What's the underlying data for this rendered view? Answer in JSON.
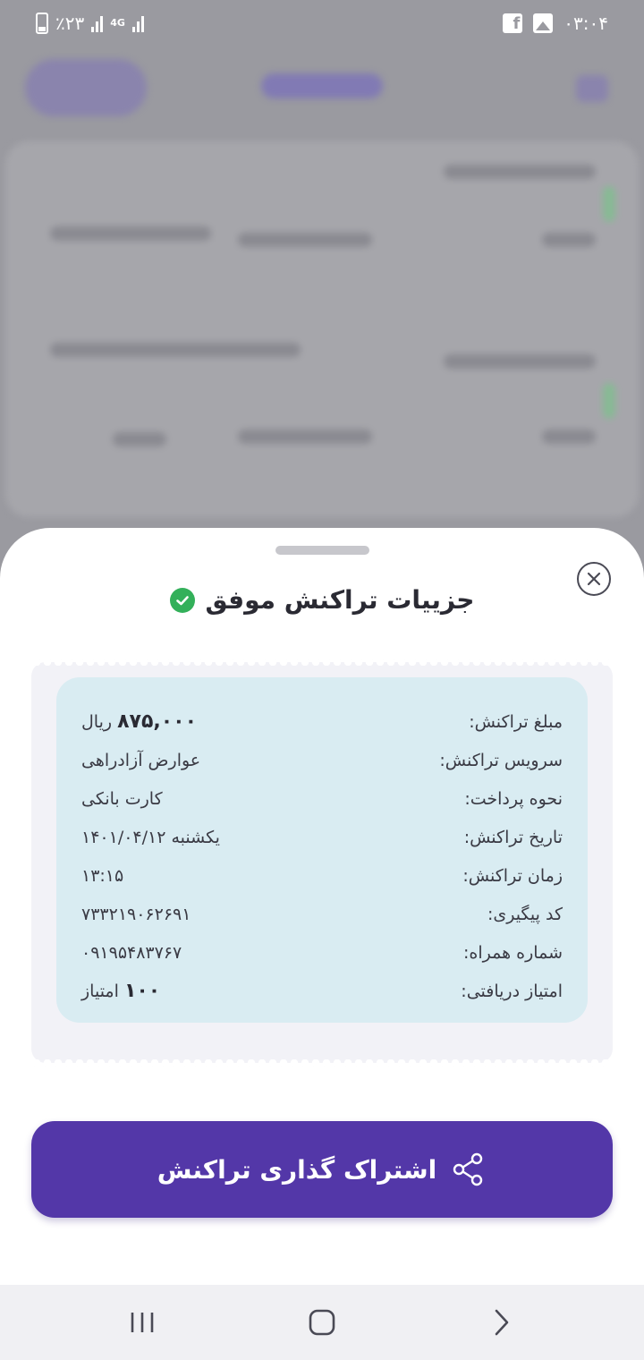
{
  "status_bar": {
    "battery": "٪۲۳",
    "network": "4G",
    "time": "۰۳:۰۴"
  },
  "sheet": {
    "title": "جزییات تراکنش موفق",
    "rows": [
      {
        "label": "مبلغ تراکنش:",
        "value_bold": "۸۷۵,۰۰۰",
        "value": "ریال"
      },
      {
        "label": "سرویس تراکنش:",
        "value": "عوارض آزادراهی"
      },
      {
        "label": "نحوه پرداخت:",
        "value": "کارت بانکی"
      },
      {
        "label": "تاریخ تراکنش:",
        "value": "یکشنبه ۱۴۰۱/۰۴/۱۲"
      },
      {
        "label": "زمان تراکنش:",
        "value": "۱۳:۱۵"
      },
      {
        "label": "کد پیگیری:",
        "value": "۷۳۳۲۱۹۰۶۲۶۹۱"
      },
      {
        "label": "شماره همراه:",
        "value": "۰۹۱۹۵۴۸۳۷۶۷"
      },
      {
        "label": "امتیاز دریافتی:",
        "value_bold": "۱۰۰",
        "value": "امتیاز"
      }
    ],
    "share_label": "اشتراک گذاری تراکنش"
  },
  "colors": {
    "accent": "#5337a8",
    "success": "#33b05a",
    "info_box": "#d9ecf2"
  }
}
